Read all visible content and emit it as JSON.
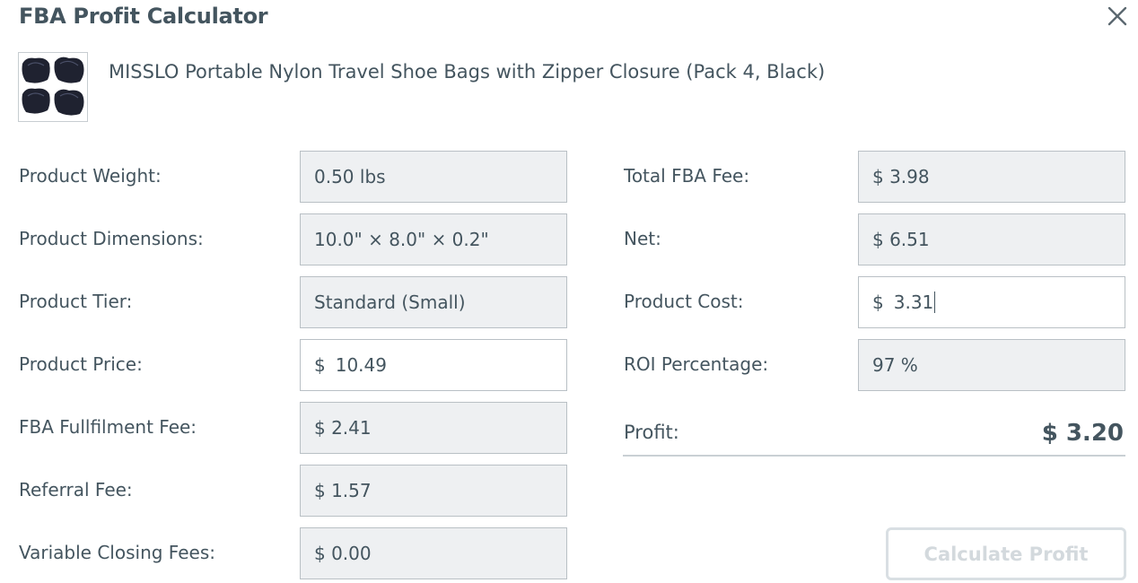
{
  "window": {
    "title": "FBA Profit Calculator",
    "close_icon": "close-icon"
  },
  "product": {
    "thumbnail_icon": "shoe-bags-thumbnail",
    "title": "MISSLO Portable Nylon Travel Shoe Bags with Zipper Closure (Pack 4, Black)"
  },
  "left_fields": [
    {
      "label": "Product Weight:",
      "value": "0.50 lbs",
      "editable": false
    },
    {
      "label": "Product Dimensions:",
      "value": "10.0\" × 8.0\" × 0.2\"",
      "editable": false
    },
    {
      "label": "Product Tier:",
      "value": "Standard (Small)",
      "editable": false
    },
    {
      "label": "Product Price:",
      "currency": "$",
      "value": "10.49",
      "editable": true
    },
    {
      "label": "FBA Fullfilment Fee:",
      "value": "$ 2.41",
      "editable": false
    },
    {
      "label": "Referral Fee:",
      "value": "$ 1.57",
      "editable": false
    },
    {
      "label": "Variable Closing Fees:",
      "value": "$ 0.00",
      "editable": false
    }
  ],
  "right_fields": [
    {
      "label": "Total FBA Fee:",
      "value": "$ 3.98",
      "editable": false
    },
    {
      "label": "Net:",
      "value": "$ 6.51",
      "editable": false
    },
    {
      "label": "Product Cost:",
      "currency": "$",
      "value": "3.31",
      "editable": true
    },
    {
      "label": "ROI Percentage:",
      "value": "97 %",
      "editable": false
    }
  ],
  "profit": {
    "label": "Profit:",
    "value": "$ 3.20"
  },
  "actions": {
    "calculate_label": "Calculate Profit"
  },
  "colors": {
    "text": "#44555f",
    "readonly_bg": "#eef0f2",
    "border": "#b9c0c5",
    "disabled_button": "#d3d9dd"
  }
}
